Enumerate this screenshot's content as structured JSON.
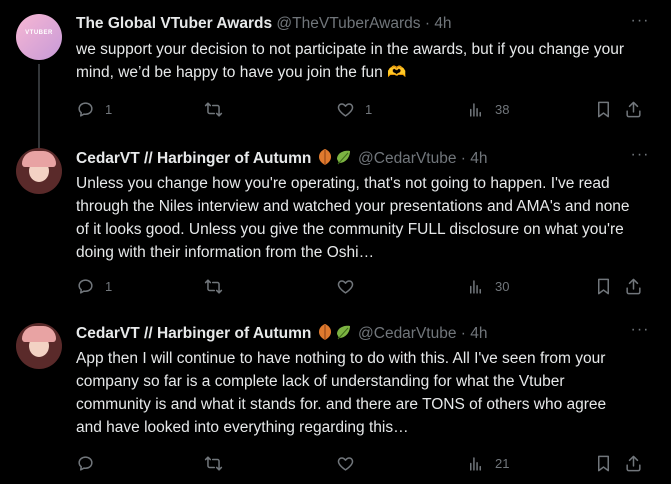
{
  "tweets": [
    {
      "author_name": "The Global VTuber Awards",
      "author_handle": "@TheVTuberAwards",
      "time": "4h",
      "avatar_text": "VTUBER",
      "text": "we support your decision to not participate in the awards, but if you change your mind, we’d be happy to have you join the fun 🫶",
      "replies": "1",
      "reposts": "",
      "likes": "1",
      "views": "38"
    },
    {
      "author_name": "CedarVT // Harbinger of Autumn",
      "author_handle": "@CedarVtube",
      "time": "4h",
      "text": "Unless you change how you're operating, that's not going to happen. I've read through the Niles interview and watched your presentations and AMA's and none of it looks good. Unless you give the community FULL disclosure on what you're doing with their information from the Oshi…",
      "replies": "1",
      "reposts": "",
      "likes": "",
      "views": "30"
    },
    {
      "author_name": "CedarVT // Harbinger of Autumn",
      "author_handle": "@CedarVtube",
      "time": "4h",
      "text": "App then I will continue to have nothing to do with this. All I've seen from your company so far is a complete lack of understanding for what the Vtuber community is and what it stands for. and there are TONS of others who agree and have looked into everything regarding this…",
      "replies": "",
      "reposts": "",
      "likes": "",
      "views": "21"
    }
  ],
  "separator": "·",
  "colors": {
    "background": "#000000",
    "text": "#e7e9ea",
    "secondary": "#71767b",
    "thread_line": "#333639"
  },
  "icons": {
    "reply": "speech-bubble-icon",
    "repost": "repost-arrows-icon",
    "like": "heart-icon",
    "views": "bar-chart-icon",
    "bookmark": "bookmark-icon",
    "share": "share-upload-icon",
    "more": "ellipsis-icon",
    "name_badges": "autumn-leaf-emoji"
  }
}
